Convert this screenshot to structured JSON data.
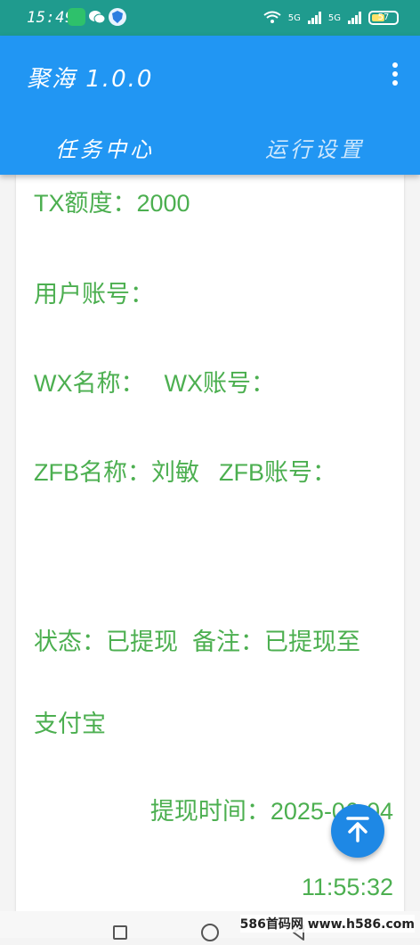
{
  "status_bar": {
    "time": "15:49",
    "network_1": "5G",
    "network_2": "5G",
    "battery": "57"
  },
  "app_bar": {
    "title": "聚海 1.0.0"
  },
  "tabs": [
    {
      "label": "任务中心",
      "active": true
    },
    {
      "label": "运行设置",
      "active": false
    }
  ],
  "record": {
    "quota": "TX额度：2000",
    "user_account": "用户账号：",
    "wx_name": "WX名称：",
    "wx_account": "WX账号：",
    "zfb_name": "ZFB名称：刘敏",
    "zfb_account": "ZFB账号：",
    "status": "状态：已提现",
    "remark": "备注：已提现至",
    "remark_cont": "支付宝",
    "time_label": "提现时间：2025-06-04",
    "time_value": "11:55:32"
  },
  "watermark": "586首码网 www.h586.com",
  "colors": {
    "status_bar": "#1f9b8e",
    "app_bar": "#2196f3",
    "text_green": "#4caf50",
    "fab": "#1e88e5"
  },
  "icons": {
    "menu": "more-vert-icon",
    "fab": "arrow-up-to-top-icon"
  }
}
